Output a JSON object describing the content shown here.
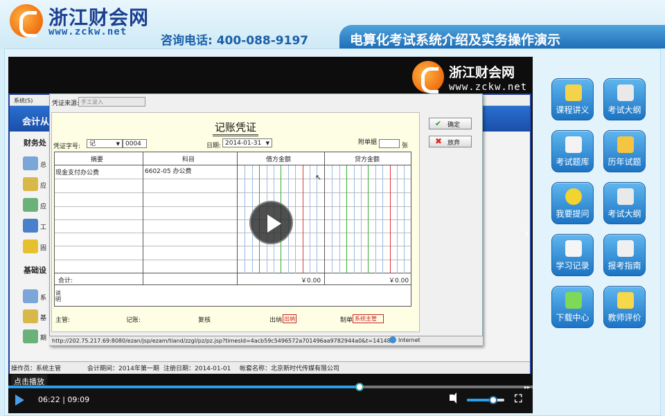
{
  "header": {
    "logo_title": "浙江财会网",
    "logo_url": "www.zckw.net",
    "hotline": "咨询电话: 400-088-9197",
    "banner_title": "电算化考试系统介绍及实务操作演示"
  },
  "video_watermark": {
    "title": "浙江财会网",
    "url": "www.zckw.net"
  },
  "app": {
    "menu_text": "系统(S)",
    "bluebar_label": "会计从",
    "section_finance": "财务处",
    "section_basic": "基础设",
    "left_items": [
      "总",
      "应",
      "应",
      "工",
      "固"
    ],
    "left_items2": [
      "系",
      "基",
      "期"
    ],
    "status": {
      "operator": "操作员：系统主管",
      "period": "会计期间：2014年第一期",
      "reg_date": "注册日期：2014-01-01",
      "account": "帐套名称：北京新时代传媒有限公司"
    }
  },
  "dialog": {
    "source_label": "凭证来源:",
    "source_value": "手工录入",
    "title": "记账凭证",
    "voucher_type_label": "凭证字号:",
    "voucher_type_value": "记",
    "voucher_no": "0004",
    "date_label": "日期:",
    "date_value": "2014-01-31",
    "attach_label": "附单据",
    "attach_unit": "张",
    "confirm_button": "确定",
    "cancel_button": "放弃",
    "columns": [
      "摘要",
      "科目",
      "借方金额",
      "贷方金额"
    ],
    "rows": [
      {
        "summary": "现金支付办公费",
        "account": "6602-05 办公费"
      }
    ],
    "total_label": "合计:",
    "debit_total": "￥0.00",
    "credit_total": "￥0.00",
    "remark_label": "说明",
    "sign": {
      "supervisor": "主管:",
      "bookkeeper": "记账:",
      "review": "复核",
      "cashier": "出纳",
      "cashier_value": "出纳",
      "maker": "制单",
      "maker_value": "系统主管"
    },
    "url_text": "http://202.75.217.69:8080/ezan/jsp/ezam/tiand/zzgl/pz/pz.jsp?timesId=4acb59c5496572a701496aa9782944a0&t=141483",
    "url_zone": "Internet"
  },
  "player": {
    "click_play": "点击播放",
    "time": "06:22 | 09:09",
    "progress": 0.67,
    "volume": 0.7
  },
  "sidebar": [
    {
      "label": "课程讲义",
      "icon": "notebook-check-icon",
      "color": "#f4d34a"
    },
    {
      "label": "考试大纲",
      "icon": "document-pencil-icon",
      "color": "#e9e9e9"
    },
    {
      "label": "考试题库",
      "icon": "calendar-icon",
      "color": "#f3f3f3"
    },
    {
      "label": "历年试题",
      "icon": "folder-open-icon",
      "color": "#f5c542"
    },
    {
      "label": "我要提问",
      "icon": "question-icon",
      "color": "#f2d330"
    },
    {
      "label": "考试大纲",
      "icon": "document-pencil-icon",
      "color": "#e9e9e9"
    },
    {
      "label": "学习记录",
      "icon": "grid-table-icon",
      "color": "#f5f5f5"
    },
    {
      "label": "报考指南",
      "icon": "clipboard-pin-icon",
      "color": "#f0f0f0"
    },
    {
      "label": "下载中心",
      "icon": "stack-download-icon",
      "color": "#7ed957"
    },
    {
      "label": "教师评价",
      "icon": "chat-bubbles-icon",
      "color": "#f7d84a"
    }
  ]
}
